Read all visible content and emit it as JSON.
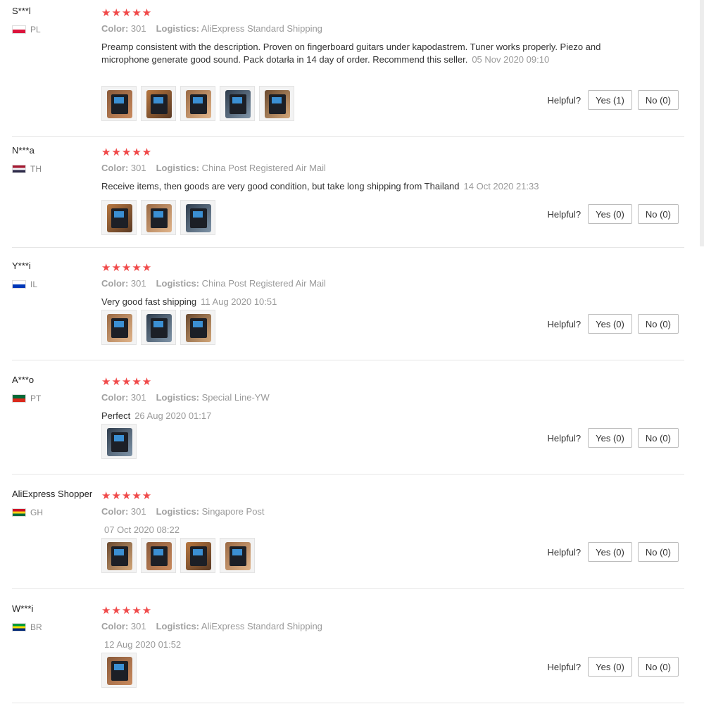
{
  "labels": {
    "color": "Color:",
    "logistics": "Logistics:",
    "helpful": "Helpful?"
  },
  "colors": {
    "star": "#f04a4a",
    "muted_text": "#9a9a9a",
    "button_border": "#bcbcbc"
  },
  "reviews": [
    {
      "user": "S***l",
      "country": "PL",
      "flag": [
        "#ffffff",
        "#dc143c"
      ],
      "stars": "★★★★★",
      "color": "301",
      "logistics": "AliExpress Standard Shipping",
      "text": "Preamp consistent with the description. Proven on fingerboard guitars under kapodastrem. Tuner works properly. Piezo and microphone generate good sound. Pack dotarła in 14 day of order. Recommend this seller.",
      "date": "05 Nov 2020 09:10",
      "thumbs": 5,
      "yes": "Yes (1)",
      "no": "No (0)"
    },
    {
      "user": "N***a",
      "country": "TH",
      "flag": [
        "#a51931",
        "#f4f5f8",
        "#2d2a4a"
      ],
      "stars": "★★★★★",
      "color": "301",
      "logistics": "China Post Registered Air Mail",
      "text": "Receive items, then goods are very good condition, but take long shipping from Thailand",
      "date": "14 Oct 2020 21:33",
      "thumbs": 3,
      "yes": "Yes (0)",
      "no": "No (0)"
    },
    {
      "user": "Y***i",
      "country": "IL",
      "flag": [
        "#ffffff",
        "#0038b8"
      ],
      "stars": "★★★★★",
      "color": "301",
      "logistics": "China Post Registered Air Mail",
      "text": "Very good fast shipping",
      "date": "11 Aug 2020 10:51",
      "thumbs": 3,
      "yes": "Yes (0)",
      "no": "No (0)"
    },
    {
      "user": "A***o",
      "country": "PT",
      "flag": [
        "#046a38",
        "#da291c"
      ],
      "stars": "★★★★★",
      "color": "301",
      "logistics": "Special Line-YW",
      "text": "Perfect",
      "date": "26 Aug 2020 01:17",
      "thumbs": 1,
      "yes": "Yes (0)",
      "no": "No (0)"
    },
    {
      "user": "AliExpress Shopper",
      "country": "GH",
      "flag": [
        "#ce1126",
        "#fcd116",
        "#006b3f"
      ],
      "stars": "★★★★★",
      "color": "301",
      "logistics": "Singapore Post",
      "text": "",
      "date": "07 Oct 2020 08:22",
      "thumbs": 4,
      "yes": "Yes (0)",
      "no": "No (0)"
    },
    {
      "user": "W***i",
      "country": "BR",
      "flag": [
        "#009c3b",
        "#ffdf00",
        "#002776"
      ],
      "stars": "★★★★★",
      "color": "301",
      "logistics": "AliExpress Standard Shipping",
      "text": "",
      "date": "12 Aug 2020 01:52",
      "thumbs": 1,
      "yes": "Yes (0)",
      "no": "No (0)"
    }
  ]
}
